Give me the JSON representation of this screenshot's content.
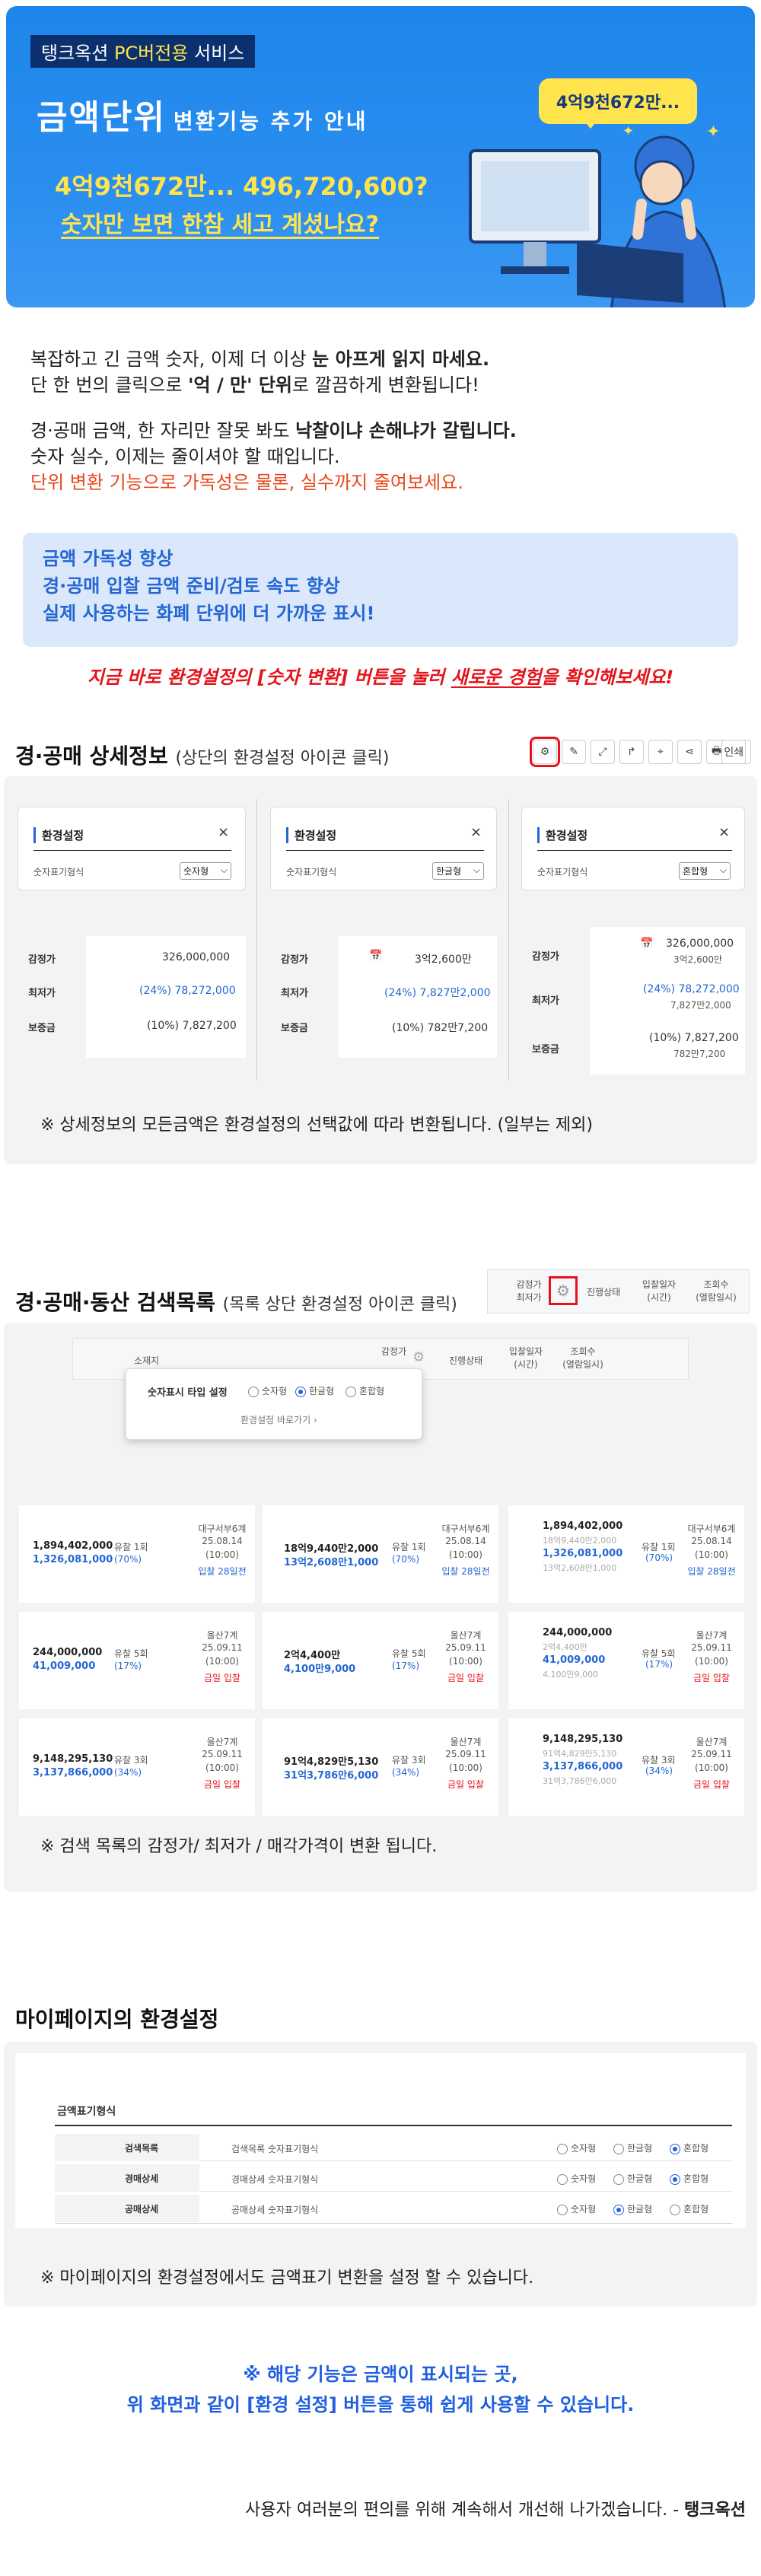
{
  "banner": {
    "tag_prefix": "탱크옥션 ",
    "tag_highlight": "PC버전용",
    "tag_suffix": " 서비스",
    "title_main": "금액단위",
    "title_sub": "변환기능 추가 안내",
    "bubble": "4억9천672만...",
    "line1": "4억9천672만... 496,720,600?",
    "line2": "숫자만 보면 한참 세고 계셨나요?"
  },
  "intro": {
    "p1a": "복잡하고 긴 금액 숫자, 이제 더 이상 ",
    "p1b": "눈 아프게 읽지 마세요.",
    "p2a": "단 한 번의 클릭으로 ",
    "p2b": "'억 / 만' 단위",
    "p2c": "로 깔끔하게 변환됩니다!",
    "p3a": "경·공매 금액, 한 자리만 잘못 봐도 ",
    "p3b": "낙찰이냐 손해냐가 갈립니다.",
    "p4": "숫자 실수, 이제는 줄이셔야 할 때입니다.",
    "p5": "단위 변환 기능으로 가독성은 물론, 실수까지 줄여보세요."
  },
  "callout": [
    "금액 가독성 향상",
    "경·공매 입찰 금액 준비/검토 속도 향상",
    "실제 사용하는 화폐 단위에 더 가까운 표시!"
  ],
  "cta": {
    "a": "지금 바로 환경설정의 [숫자 변환] 버튼을 눌러 ",
    "b": "새로운 경험",
    "c": "을 확인해보세요!"
  },
  "detail": {
    "heading": "경·공매 상세정보",
    "heading_sub": "(상단의 환경설정 아이콘 클릭)",
    "toolbar_print": "인쇄",
    "settings_title": "환경설정",
    "field_label": "숫자표기형식",
    "options": [
      "숫자형",
      "한글형",
      "혼합형"
    ],
    "rows": [
      "감정가",
      "최저가",
      "보증금"
    ],
    "card1": {
      "appraisal": "326,000,000",
      "min": "(24%) 78,272,000",
      "deposit": "(10%) 7,827,200"
    },
    "card2": {
      "appraisal": "3억2,600만",
      "min": "(24%) 7,827만2,000",
      "deposit": "(10%) 782만7,200"
    },
    "card3": {
      "appraisal": "326,000,000",
      "appraisal2": "3억2,600만",
      "min": "(24%) 78,272,000",
      "min2": "7,827만2,000",
      "deposit": "(10%) 7,827,200",
      "deposit2": "782만7,200"
    },
    "note": "※ 상세정보의 모든금액은 환경설정의 선택값에 따라 변환됩니다. (일부는 제외)"
  },
  "list": {
    "heading": "경·공매·동산 검색목록",
    "heading_sub": "(목록 상단 환경설정 아이콘 클릭)",
    "header_cols": [
      "감정가\n최저가",
      "진행상태",
      "입찰일자\n(시간)",
      "조회수\n(열람일시)"
    ],
    "inner_cols": [
      "소재지",
      "감정가",
      "진행상태",
      "입찰일자\n(시간)",
      "조회수\n(열람일시)"
    ],
    "popup_title": "숫자표시 타입 설정",
    "popup_options": [
      "숫자형",
      "한글형",
      "혼합형"
    ],
    "popup_link": "환경설정 바로가기 ›",
    "cols": [
      [
        {
          "a": "1,894,402,000",
          "b": "1,326,081,000",
          "s": "유찰 1회",
          "p": "(70%)",
          "c": "대구서부6계",
          "d": "25.08.14",
          "t": "(10:00)",
          "e": "입찰 28일전"
        },
        {
          "a": "244,000,000",
          "b": "41,009,000",
          "s": "유찰 5회",
          "p": "(17%)",
          "c": "울산7계",
          "d": "25.09.11",
          "t": "(10:00)",
          "e": "금일 입찰"
        },
        {
          "a": "9,148,295,130",
          "b": "3,137,866,000",
          "s": "유찰 3회",
          "p": "(34%)",
          "c": "울산7계",
          "d": "25.09.11",
          "t": "(10:00)",
          "e": "금일 입찰"
        }
      ],
      [
        {
          "a": "18억9,440만2,000",
          "b": "13억2,608만1,000",
          "s": "유찰 1회",
          "p": "(70%)",
          "c": "대구서부6계",
          "d": "25.08.14",
          "t": "(10:00)",
          "e": "입찰 28일전"
        },
        {
          "a": "2억4,400만",
          "b": "4,100만9,000",
          "s": "유찰 5회",
          "p": "(17%)",
          "c": "울산7계",
          "d": "25.09.11",
          "t": "(10:00)",
          "e": "금일 입찰"
        },
        {
          "a": "91억4,829만5,130",
          "b": "31억3,786만6,000",
          "s": "유찰 3회",
          "p": "(34%)",
          "c": "울산7계",
          "d": "25.09.11",
          "t": "(10:00)",
          "e": "금일 입찰"
        }
      ],
      [
        {
          "a": "1,894,402,000",
          "a2": "18억9,440만2,000",
          "b": "1,326,081,000",
          "b2": "13억2,608만1,000",
          "s": "유찰 1회",
          "p": "(70%)",
          "c": "대구서부6계",
          "d": "25.08.14",
          "t": "(10:00)",
          "e": "입찰 28일전"
        },
        {
          "a": "244,000,000",
          "a2": "2억4,400만",
          "b": "41,009,000",
          "b2": "4,100만9,000",
          "s": "유찰 5회",
          "p": "(17%)",
          "c": "울산7계",
          "d": "25.09.11",
          "t": "(10:00)",
          "e": "금일 입찰"
        },
        {
          "a": "9,148,295,130",
          "a2": "91억4,829만5,130",
          "b": "3,137,866,000",
          "b2": "31억3,786만6,000",
          "s": "유찰 3회",
          "p": "(34%)",
          "c": "울산7계",
          "d": "25.09.11",
          "t": "(10:00)",
          "e": "금일 입찰"
        }
      ]
    ],
    "note": "※ 검색 목록의 감정가/ 최저가 / 매각가격이 변환 됩니다."
  },
  "mypage": {
    "heading": "마이페이지의 환경설정",
    "section": "금액표기형식",
    "rows": [
      {
        "name": "검색목록",
        "desc": "검색목록 숫자표기형식",
        "selected": 2
      },
      {
        "name": "경매상세",
        "desc": "경매상세 숫자표기형식",
        "selected": 2
      },
      {
        "name": "공매상세",
        "desc": "공매상세 숫자표기형식",
        "selected": 1
      }
    ],
    "options": [
      "숫자형",
      "한글형",
      "혼합형"
    ],
    "note": "※ 마이페이지의 환경설정에서도 금액표기 변환을 설정 할 수 있습니다."
  },
  "final": {
    "line1": "※ 해당 기능은 금액이 표시되는 곳,",
    "line2": "위 화면과 같이 [환경 설정] 버튼을 통해 쉽게 사용할 수 있습니다.",
    "sign": "사용자 여러분의 편의를 위해 계속해서 개선해 나가겠습니다. - ",
    "brand": "탱크옥션"
  }
}
